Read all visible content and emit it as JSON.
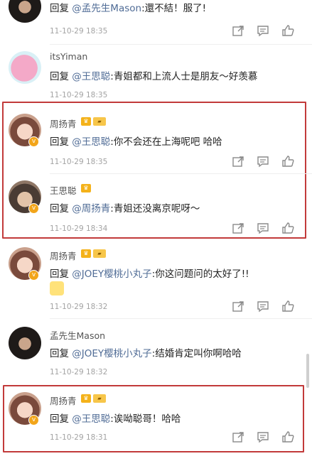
{
  "comments": [
    {
      "id": "c1",
      "avatar": "dark",
      "name": "",
      "badges": [],
      "reply_prefix": "回复",
      "at": "@孟先生Mason",
      "body": ":還不結！服了!",
      "time": "11-10-29 18:35"
    },
    {
      "id": "c2",
      "avatar": "pig",
      "name": "itsYiman",
      "badges": [],
      "reply_prefix": "回复",
      "at": "@王思聪",
      "body": ":青姐都和上流人士是朋友～好羡慕",
      "time": "11-10-29 18:35"
    },
    {
      "id": "c3",
      "avatar": "girl",
      "name": "周扬青",
      "badges": [
        "crown",
        "vip"
      ],
      "reply_prefix": "回复",
      "at": "@王思聪",
      "body": ":你不会还在上海呢吧 哈哈",
      "time": "11-10-29 18:35"
    },
    {
      "id": "c4",
      "avatar": "boy",
      "name": "王思聪",
      "badges": [
        "crown"
      ],
      "reply_prefix": "回复",
      "at": "@周扬青",
      "body": ":青姐还没离京呢呀～",
      "time": "11-10-29 18:34"
    },
    {
      "id": "c5",
      "avatar": "girl",
      "name": "周扬青",
      "badges": [
        "crown",
        "vip"
      ],
      "reply_prefix": "回复",
      "at": "@JOEY樱桃小丸子",
      "body": ":你这问题问的太好了!!",
      "time": "11-10-29 18:32"
    },
    {
      "id": "c6",
      "avatar": "dark",
      "name": "孟先生Mason",
      "badges": [],
      "reply_prefix": "回复",
      "at": "@JOEY樱桃小丸子",
      "body": ":结婚肯定叫你啊哈哈",
      "time": "11-10-29 18:32"
    },
    {
      "id": "c7",
      "avatar": "girl",
      "name": "周扬青",
      "badges": [
        "crown",
        "vip"
      ],
      "reply_prefix": "回复",
      "at": "@王思聪",
      "body": ":诶呦聪哥！哈哈",
      "time": "11-10-29 18:31"
    }
  ],
  "icons": {
    "repost": "repost-icon",
    "comment": "comment-icon",
    "like": "like-icon",
    "verified": "verified-badge-icon"
  },
  "colors": {
    "mention": "#506c96",
    "time": "#a3a3a3",
    "highlight": "#c23a3a",
    "vip": "#f4b21a"
  }
}
